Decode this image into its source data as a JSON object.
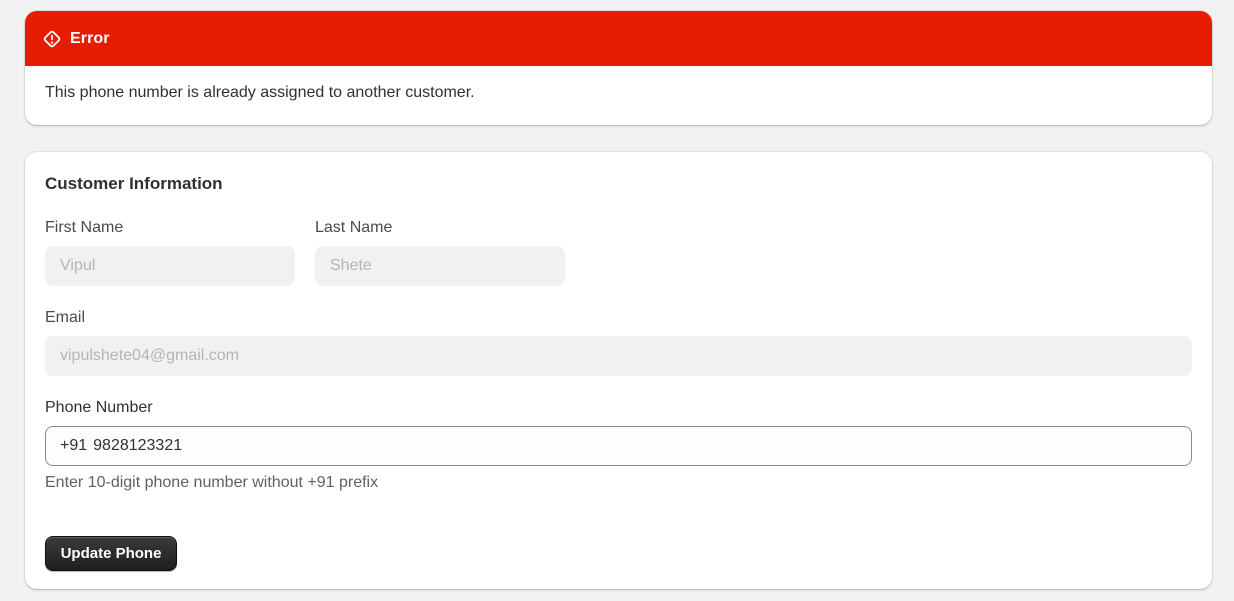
{
  "error_banner": {
    "title": "Error",
    "message": "This phone number is already assigned to another customer.",
    "icon": "alert-diamond-icon",
    "color": "#e51c00"
  },
  "customer_form": {
    "section_title": "Customer Information",
    "first_name": {
      "label": "First Name",
      "value": "Vipul"
    },
    "last_name": {
      "label": "Last Name",
      "value": "Shete"
    },
    "email": {
      "label": "Email",
      "value": "vipulshete04@gmail.com"
    },
    "phone": {
      "label": "Phone Number",
      "prefix": "+91",
      "value": "9828123321",
      "help_text": "Enter 10-digit phone number without +91 prefix"
    },
    "submit_label": "Update Phone"
  }
}
